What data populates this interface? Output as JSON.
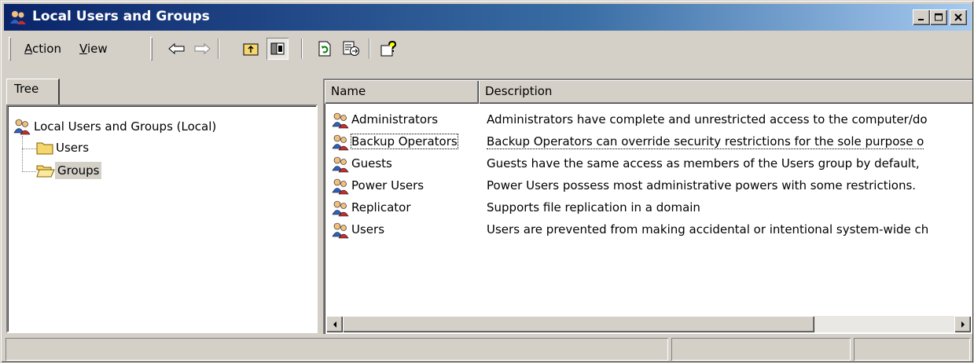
{
  "window": {
    "title": "Local Users and Groups",
    "controls": {
      "minimize_icon": "minimize-icon",
      "maximize_icon": "maximize-icon",
      "close_icon": "close-icon"
    }
  },
  "menu": {
    "action": {
      "accel": "A",
      "rest": "ction"
    },
    "view": {
      "accel": "V",
      "rest": "iew"
    }
  },
  "toolbar": {
    "buttons": [
      "back-arrow-icon",
      "forward-arrow-icon",
      "up-one-level-icon",
      "show-hide-tree-icon",
      "refresh-icon",
      "export-list-icon",
      "help-icon"
    ]
  },
  "tree": {
    "tab_label": "Tree",
    "root": "Local Users and Groups (Local)",
    "children": [
      {
        "label": "Users",
        "selected": false
      },
      {
        "label": "Groups",
        "selected": true
      }
    ]
  },
  "list": {
    "columns": [
      "Name",
      "Description"
    ],
    "rows": [
      {
        "name": "Administrators",
        "description": "Administrators have complete and unrestricted access to the computer/do"
      },
      {
        "name": "Backup Operators",
        "description": "Backup Operators can override security restrictions for the sole purpose o"
      },
      {
        "name": "Guests",
        "description": "Guests have the same access as members of the Users group by default, "
      },
      {
        "name": "Power Users",
        "description": "Power Users possess most administrative powers with some restrictions."
      },
      {
        "name": "Replicator",
        "description": "Supports file replication in a domain"
      },
      {
        "name": "Users",
        "description": "Users are prevented from making accidental or intentional system-wide ch"
      }
    ],
    "focused_row": 1
  },
  "status_bar": {
    "panels": [
      "",
      "",
      ""
    ]
  },
  "colors": {
    "title_start": "#0a246a",
    "title_end": "#a6caf0",
    "face": "#d4d0c8",
    "folder": "#f5d76e"
  }
}
